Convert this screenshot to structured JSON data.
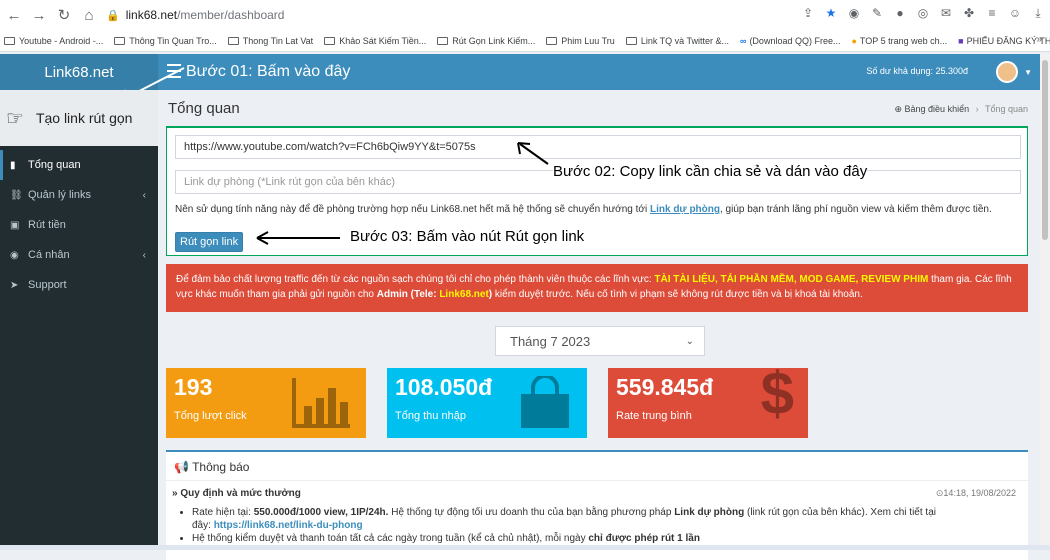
{
  "browser": {
    "url_host": "link68.net",
    "url_path": "/member/dashboard",
    "nav": [
      "back-icon",
      "forward-icon",
      "reload-icon",
      "home-icon"
    ],
    "bookmarks": [
      "Youtube - Android -...",
      "Thông Tin Quan Tro...",
      "Thong Tin Lat Vat",
      "Khảo Sát Kiếm Tiền...",
      "Rút Gọn Link Kiếm...",
      "Phim Luu Tru",
      "Link TQ và Twitter &...",
      "(Download QQ) Free...",
      "TOP 5 trang web ch...",
      "PHIẾU ĐĂNG KÝ TH..."
    ],
    "bookmarks_more": "»"
  },
  "header": {
    "logo": "Link68.net",
    "step1": "Bước 01: Bấm vào đây",
    "balance": "Số dư khả dụng: 25.300đ"
  },
  "sidebar": {
    "create_link": "Tạo link rút gọn",
    "items": [
      {
        "icon": "bar-chart-icon",
        "glyph": "📊",
        "label": "Tổng quan",
        "caret": ""
      },
      {
        "icon": "link-icon",
        "glyph": "🔗",
        "label": "Quản lý links",
        "caret": "‹"
      },
      {
        "icon": "money-icon",
        "glyph": "💵",
        "label": "Rút tiền",
        "caret": ""
      },
      {
        "icon": "user-icon",
        "glyph": "👤",
        "label": "Cá nhân",
        "caret": "‹"
      },
      {
        "icon": "support-icon",
        "glyph": "➤",
        "label": "Support",
        "caret": ""
      }
    ]
  },
  "main": {
    "title": "Tổng quan",
    "breadcrumb": {
      "home": "Bảng điều khiển",
      "sep": "›",
      "current": "Tổng quan"
    },
    "link_input_value": "https://www.youtube.com/watch?v=FCh6bQiw9YY&t=5075s",
    "backup_placeholder": "Link dự phòng (*Link rút gọn của bên khác)",
    "note_before": "Nên sử dụng tính năng này để đề phòng trường hợp nếu Link68.net hết mã hệ thống sẽ chuyển hướng tới ",
    "note_link": "Link dự phòng",
    "note_after": ", giúp bạn tránh lãng phí nguồn view và kiếm thêm được tiền.",
    "shorten_button": "Rút gọn link",
    "step2": "Bước 02: Copy link cần chia sẻ và dán vào đây",
    "step3": "Bước 03: Bấm vào nút Rút gọn link",
    "alert": {
      "p1": "Để đảm bảo chất lượng traffic đến từ các nguồn sạch chúng tôi chỉ cho phép thành viên thuộc các lĩnh vực: ",
      "h1": "TÀI TÀI LIỆU, TẢI PHẦN MỀM, MOD GAME, REVIEW PHIM",
      "p2": " tham gia. Các lĩnh vực khác muốn tham gia phải gửi nguồn cho ",
      "b1": "Admin (Tele: ",
      "h2": "Link68.net",
      "b2": ")",
      "p3": " kiểm duyệt trước. Nếu cố tình vi phạm sẽ không rút được tiền và bị khoá tài khoản."
    },
    "month": "Tháng 7 2023",
    "stats": [
      {
        "value": "193",
        "label": "Tổng lượt click",
        "color": "#f39c12"
      },
      {
        "value": "108.050đ",
        "label": "Tổng thu nhập",
        "color": "#00c0ef"
      },
      {
        "value": "559.845đ",
        "label": "Rate trung bình",
        "color": "#dd4b39"
      }
    ],
    "news": {
      "heading": "Thông báo",
      "item_title": "» Quy định và mức thưởng",
      "date": "⊙14:18, 19/08/2022",
      "b1_pre": "Rate hiện tại: ",
      "b1_bold": "550.000đ/1000 view, 1IP/24h.",
      "b1_mid": " Hệ thống tự động tối ưu doanh thu của bạn bằng phương pháp ",
      "b1_bold2": "Link dự phòng",
      "b1_post": " (link rút gọn của bên khác). Xem chi tiết tại",
      "b1_line2": "đây: ",
      "b1_link": "https://link68.net/link-du-phong",
      "b2_pre": "Hệ thống kiểm duyệt và thanh toán tất cả các ngày trong tuần (kể cả chủ nhật), mỗi ngày ",
      "b2_bold": "chỉ được phép rút 1 lần"
    }
  },
  "colors": {
    "header": "#3c8dbc",
    "sidebar": "#222d32",
    "success": "#00a65a",
    "danger": "#dd4b39"
  }
}
